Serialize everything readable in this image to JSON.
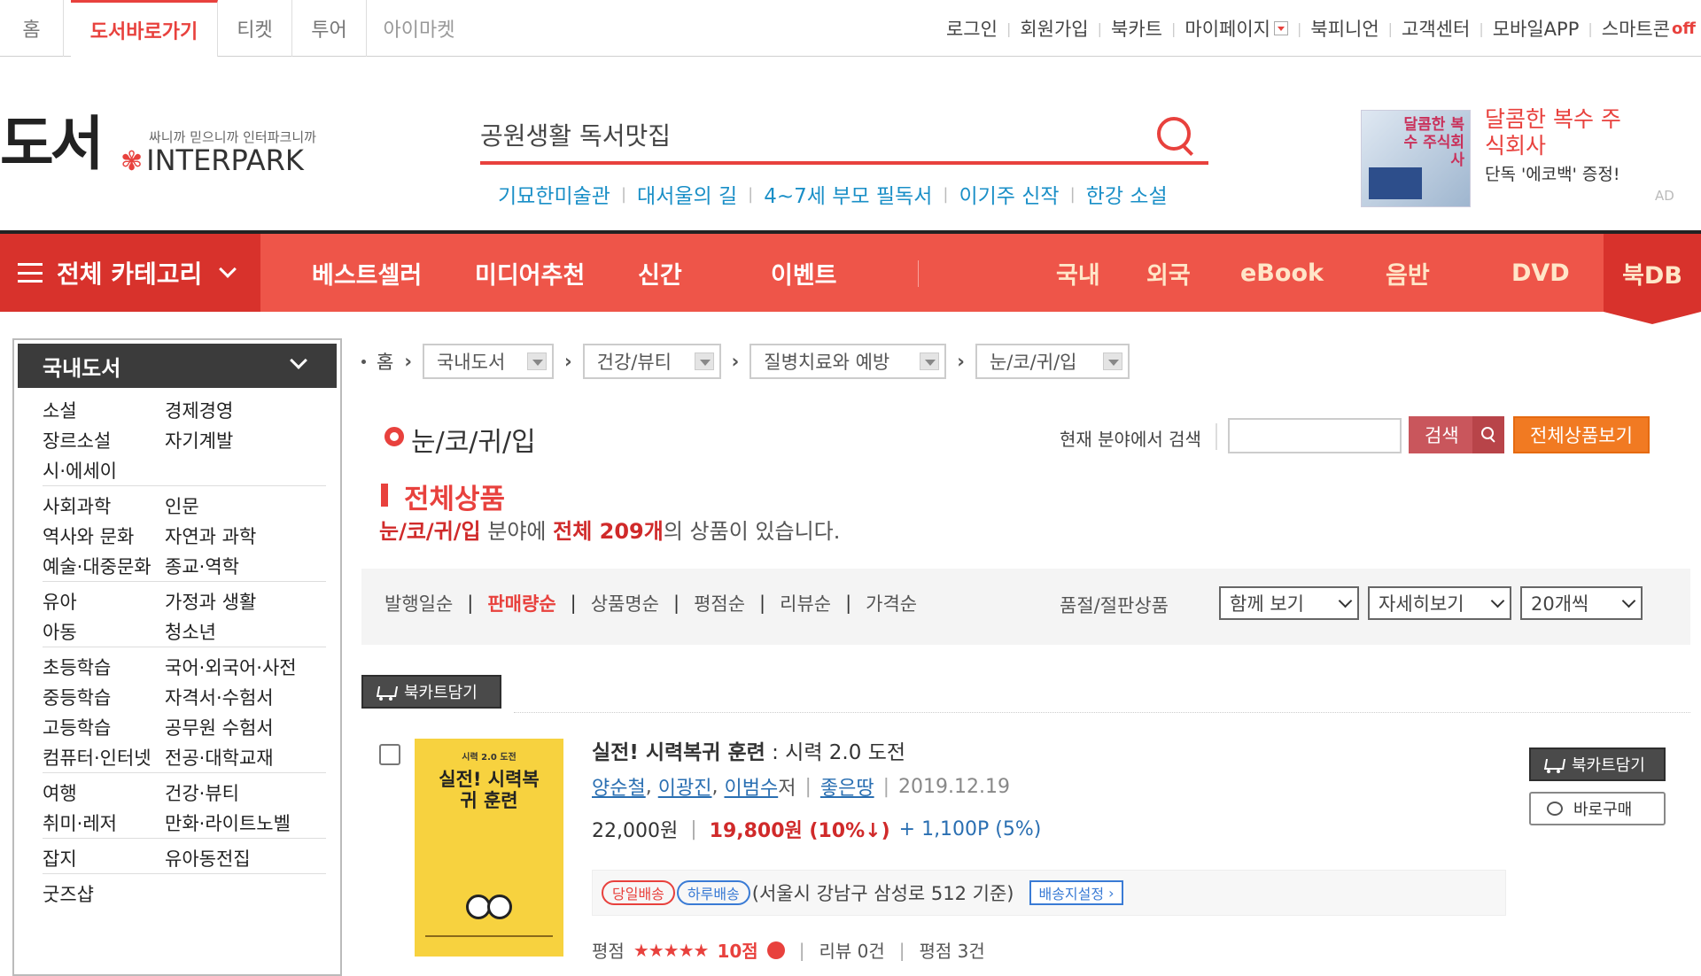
{
  "topbar": {
    "tabs": [
      {
        "label": "홈"
      },
      {
        "label": "도서바로가기",
        "active": true
      },
      {
        "label": "티켓"
      },
      {
        "label": "투어"
      },
      {
        "label": "아이마켓"
      }
    ],
    "links": [
      "로그인",
      "회원가입",
      "북카트",
      "마이페이지",
      "북피니언",
      "고객센터",
      "모바일APP",
      "스마트콘"
    ],
    "off_label": "off"
  },
  "header": {
    "logo_text": "도서",
    "slogan": "싸니까 믿으니까 인터파크니까",
    "brand": "INTERPARK",
    "search": {
      "value": "공원생활 독서맛집"
    },
    "keywords": [
      "기묘한미술관",
      "대서울의 길",
      "4~7세 부모 필독서",
      "이기주 신작",
      "한강 소설"
    ],
    "ad": {
      "cover_text": "달콤한 복수 주식회사",
      "title": "달콤한 복수 주식회사",
      "subtitle": "단독 '에코백' 증정!",
      "tag": "AD"
    }
  },
  "nav": {
    "category_label": "전체 카테고리",
    "items": [
      "베스트셀러",
      "미디어추천",
      "신간",
      "이벤트"
    ],
    "right_items": [
      "국내",
      "외국",
      "eBook",
      "음반",
      "DVD"
    ],
    "bookdb": "북DB"
  },
  "sidebar": {
    "title": "국내도서",
    "groups": [
      [
        [
          "소설",
          "경제경영"
        ],
        [
          "장르소설",
          "자기계발"
        ],
        [
          "시·에세이",
          ""
        ]
      ],
      [
        [
          "사회과학",
          "인문"
        ],
        [
          "역사와 문화",
          "자연과 과학"
        ],
        [
          "예술·대중문화",
          "종교·역학"
        ]
      ],
      [
        [
          "유아",
          "가정과 생활"
        ],
        [
          "아동",
          "청소년"
        ]
      ],
      [
        [
          "초등학습",
          "국어·외국어·사전"
        ],
        [
          "중등학습",
          "자격서·수험서"
        ],
        [
          "고등학습",
          "공무원 수험서"
        ],
        [
          "컴퓨터·인터넷",
          "전공·대학교재"
        ]
      ],
      [
        [
          "여행",
          "건강·뷰티"
        ],
        [
          "취미·레저",
          "만화·라이트노벨"
        ]
      ],
      [
        [
          "잡지",
          "유아동전집"
        ]
      ],
      [
        [
          "굿즈샵",
          ""
        ]
      ]
    ]
  },
  "breadcrumb": {
    "home": "홈",
    "levels": [
      "국내도서",
      "건강/뷰티",
      "질병치료와 예방",
      "눈/코/귀/입"
    ]
  },
  "category": {
    "title": "눈/코/귀/입",
    "search_label": "현재 분야에서 검색",
    "search_button": "검색",
    "all_products_button": "전체상품보기"
  },
  "section": {
    "title": "전체상품",
    "count_prefix_cat": "눈/코/귀/입",
    "count_mid": " 분야에 ",
    "count_total": "전체 209개",
    "count_suffix": "의 상품이 있습니다."
  },
  "sort": {
    "options": [
      "발행일순",
      "판매량순",
      "상품명순",
      "평점순",
      "리뷰순",
      "가격순"
    ],
    "active": "판매량순",
    "soldout_label": "품절/절판상품",
    "select_view": "함께 보기",
    "select_detail": "자세히보기",
    "select_count": "20개씩"
  },
  "cart_button": "북카트담기",
  "product": {
    "cover_super": "시력 2.0 도전",
    "cover_title": "실전! 시력복귀 훈련",
    "title": "실전! 시력복귀 훈련",
    "subtitle": " : 시력 2.0 도전",
    "authors": [
      "양순철",
      "이광진",
      "이범수"
    ],
    "author_suffix": " 저",
    "publisher": "좋은땅",
    "date": "2019.12.19",
    "list_price": "22,000원",
    "sale_price": "19,800원 (10%↓)",
    "points": "+ 1,100P (5%)",
    "ship_badges": [
      "당일배송",
      "하루배송"
    ],
    "ship_text": "(서울시 강남구 삼성로 512 기준)",
    "ship_setting": "배송지설정",
    "rating_label": "평점",
    "stars": "★★★★★",
    "rating_score": "10점",
    "review_count": "리뷰 0건",
    "rating_count": "평점 3건",
    "cart_button": "북카트담기",
    "buy_button": "바로구매"
  },
  "colors": {
    "accent": "#e8413d",
    "nav": "#ee5549",
    "link": "#2a6fb2",
    "keyword": "#1a8fc7",
    "orange": "#f17a22"
  }
}
